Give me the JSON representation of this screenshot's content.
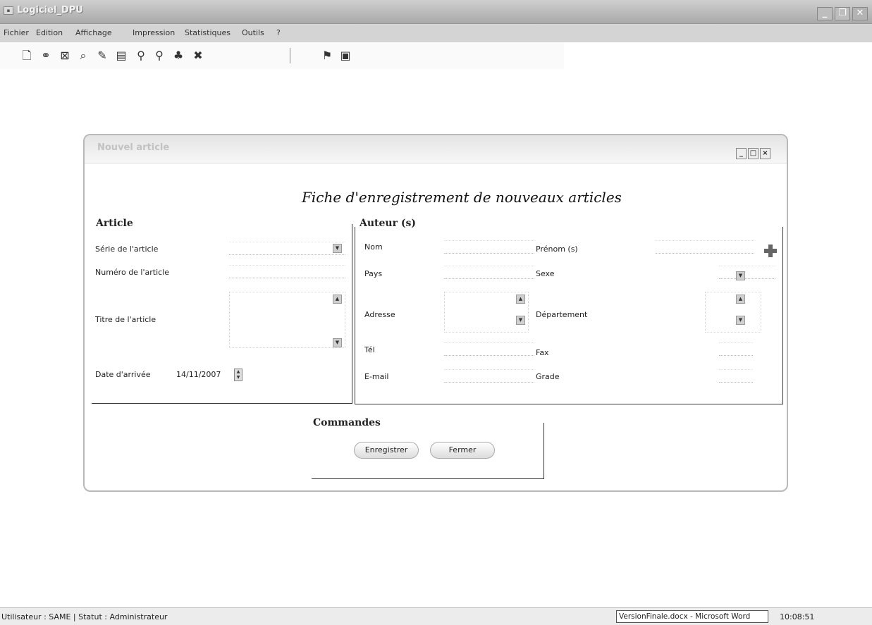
{
  "app": {
    "title": "Logiciel_DPU",
    "icon": "app-icon"
  },
  "menu": {
    "items": [
      "Fichier",
      "Edition",
      "Affichage",
      "Impression",
      "Statistiques",
      "Outils",
      "?"
    ]
  },
  "toolbar": {
    "icons": [
      "new-document-icon",
      "link-icon",
      "close-document-icon",
      "search-icon",
      "edit-icon",
      "report-icon",
      "zoom-icon",
      "zoom-alt-icon",
      "users-icon",
      "tools-icon",
      "flag-icon",
      "display-icon"
    ]
  },
  "child_window": {
    "title": "Nouvel article",
    "heading": "Fiche d'enregistrement de nouveaux articles"
  },
  "article": {
    "group_label": "Article",
    "serie_label": "Série de l'article",
    "numero_label": "Numéro de l'article",
    "titre_label": "Titre de l'article",
    "date_label": "Date d'arrivée",
    "date_value": "14/11/2007"
  },
  "auteur": {
    "group_label": "Auteur (s)",
    "nom_label": "Nom",
    "prenom_label": "Prénom (s)",
    "pays_label": "Pays",
    "sexe_label": "Sexe",
    "adresse_label": "Adresse",
    "departement_label": "Département",
    "tel_label": "Tél",
    "fax_label": "Fax",
    "email_label": "E-mail",
    "grade_label": "Grade"
  },
  "commandes": {
    "group_label": "Commandes",
    "save_label": "Enregistrer",
    "close_label": "Fermer"
  },
  "statusbar": {
    "user_info": "Utilisateur : SAME  |  Statut : Administrateur",
    "task": "VersionFinale.docx - Microsoft Word",
    "time": "10:08:51"
  }
}
